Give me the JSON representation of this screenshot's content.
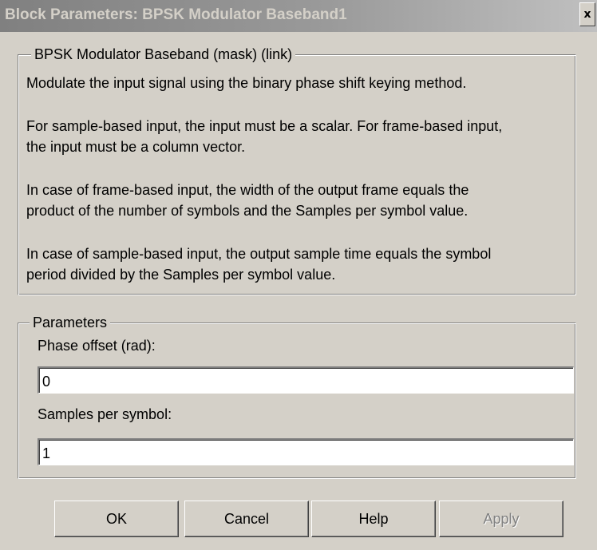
{
  "window": {
    "title": "Block Parameters: BPSK Modulator Baseband1",
    "close_glyph": "x"
  },
  "description": {
    "legend": "BPSK Modulator Baseband (mask) (link)",
    "lines": [
      "Modulate the input signal using the binary phase shift keying method.",
      "For sample-based input, the input must be a scalar. For frame-based input,",
      "the input must be a column vector.",
      "In case of frame-based input, the width of the output frame equals the",
      "product of the number of symbols and the Samples per symbol value.",
      "In case of sample-based input, the output sample time equals the symbol",
      "period divided by the Samples per symbol value."
    ]
  },
  "parameters": {
    "legend": "Parameters",
    "phase_offset": {
      "label": "Phase offset (rad):",
      "value": "0"
    },
    "samples_per_symbol": {
      "label": "Samples per symbol:",
      "value": "1"
    }
  },
  "buttons": {
    "ok": "OK",
    "cancel": "Cancel",
    "help": "Help",
    "apply": "Apply"
  },
  "colors": {
    "window_bg": "#d4d0c8",
    "titlebar_inactive": "#808080",
    "disabled_text": "#808080"
  }
}
